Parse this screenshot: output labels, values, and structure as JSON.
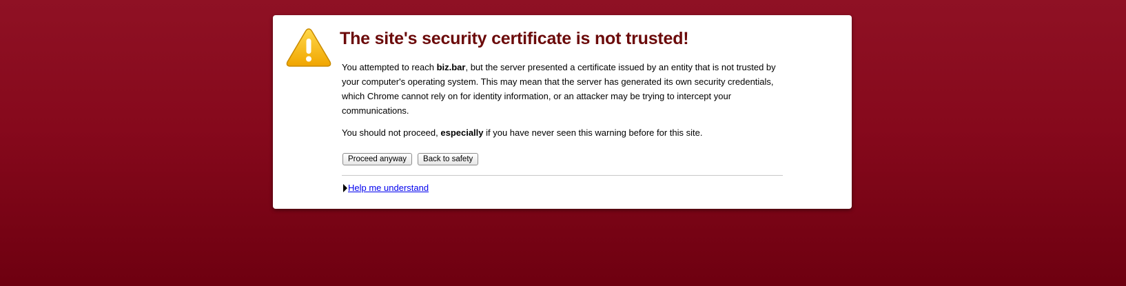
{
  "page": {
    "background_color_top": "#8f1124",
    "background_color_bottom": "#6e0010"
  },
  "card": {
    "icon": "warning-triangle-icon",
    "title": "The site's security certificate is not trusted!",
    "title_color": "#6b0a0a",
    "paragraph1": {
      "before_host": "You attempted to reach ",
      "host": "biz.bar",
      "after_host": ", but the server presented a certificate issued by an entity that is not trusted by your computer's operating system. This may mean that the server has generated its own security credentials, which Chrome cannot rely on for identity information, or an attacker may be trying to intercept your communications."
    },
    "paragraph2": {
      "before_emphasis": "You should not proceed, ",
      "emphasis": "especially",
      "after_emphasis": " if you have never seen this warning before for this site."
    },
    "buttons": {
      "proceed_label": "Proceed anyway",
      "back_label": "Back to safety"
    },
    "help": {
      "expand_icon": "disclosure-triangle-icon",
      "link_label": "Help me understand",
      "link_color": "#0000ee"
    }
  }
}
